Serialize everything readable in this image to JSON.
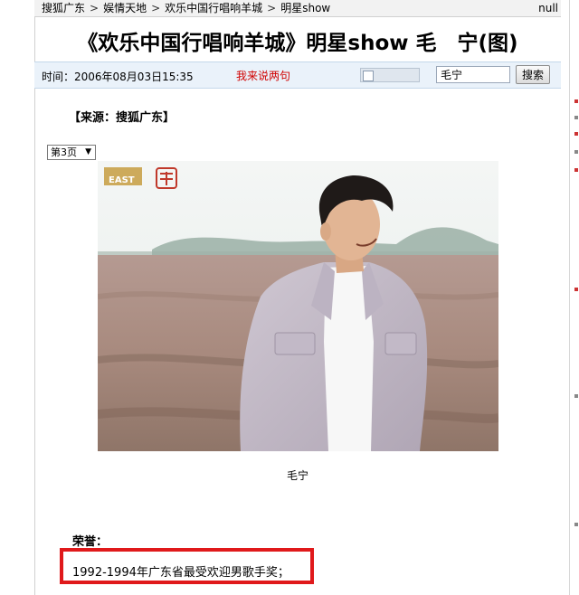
{
  "breadcrumb": {
    "items": [
      "搜狐广东",
      "娱情天地",
      "欢乐中国行唱响羊城",
      "明星show"
    ],
    "separator": ">",
    "right_text": "null"
  },
  "headline": "《欢乐中国行唱响羊城》明星show 毛　宁(图)",
  "infobar": {
    "time_label": "时间：2006年08月03日15:35",
    "comment_link": "我来说两句",
    "search_value": "毛宁",
    "search_button": "搜索"
  },
  "source": "【来源：搜狐广东】",
  "page_select": {
    "value": "第3页",
    "arrow": "▼"
  },
  "photo": {
    "logo_text": "EAST",
    "caption": "毛宁"
  },
  "honors": {
    "title": "荣誉：",
    "items": [
      "1992-1994年广东省最受欢迎男歌手奖；"
    ]
  },
  "colors": {
    "infobar_bg": "#eaf2fa",
    "comment_link": "#d00000",
    "highlight_box": "#e0191b"
  }
}
